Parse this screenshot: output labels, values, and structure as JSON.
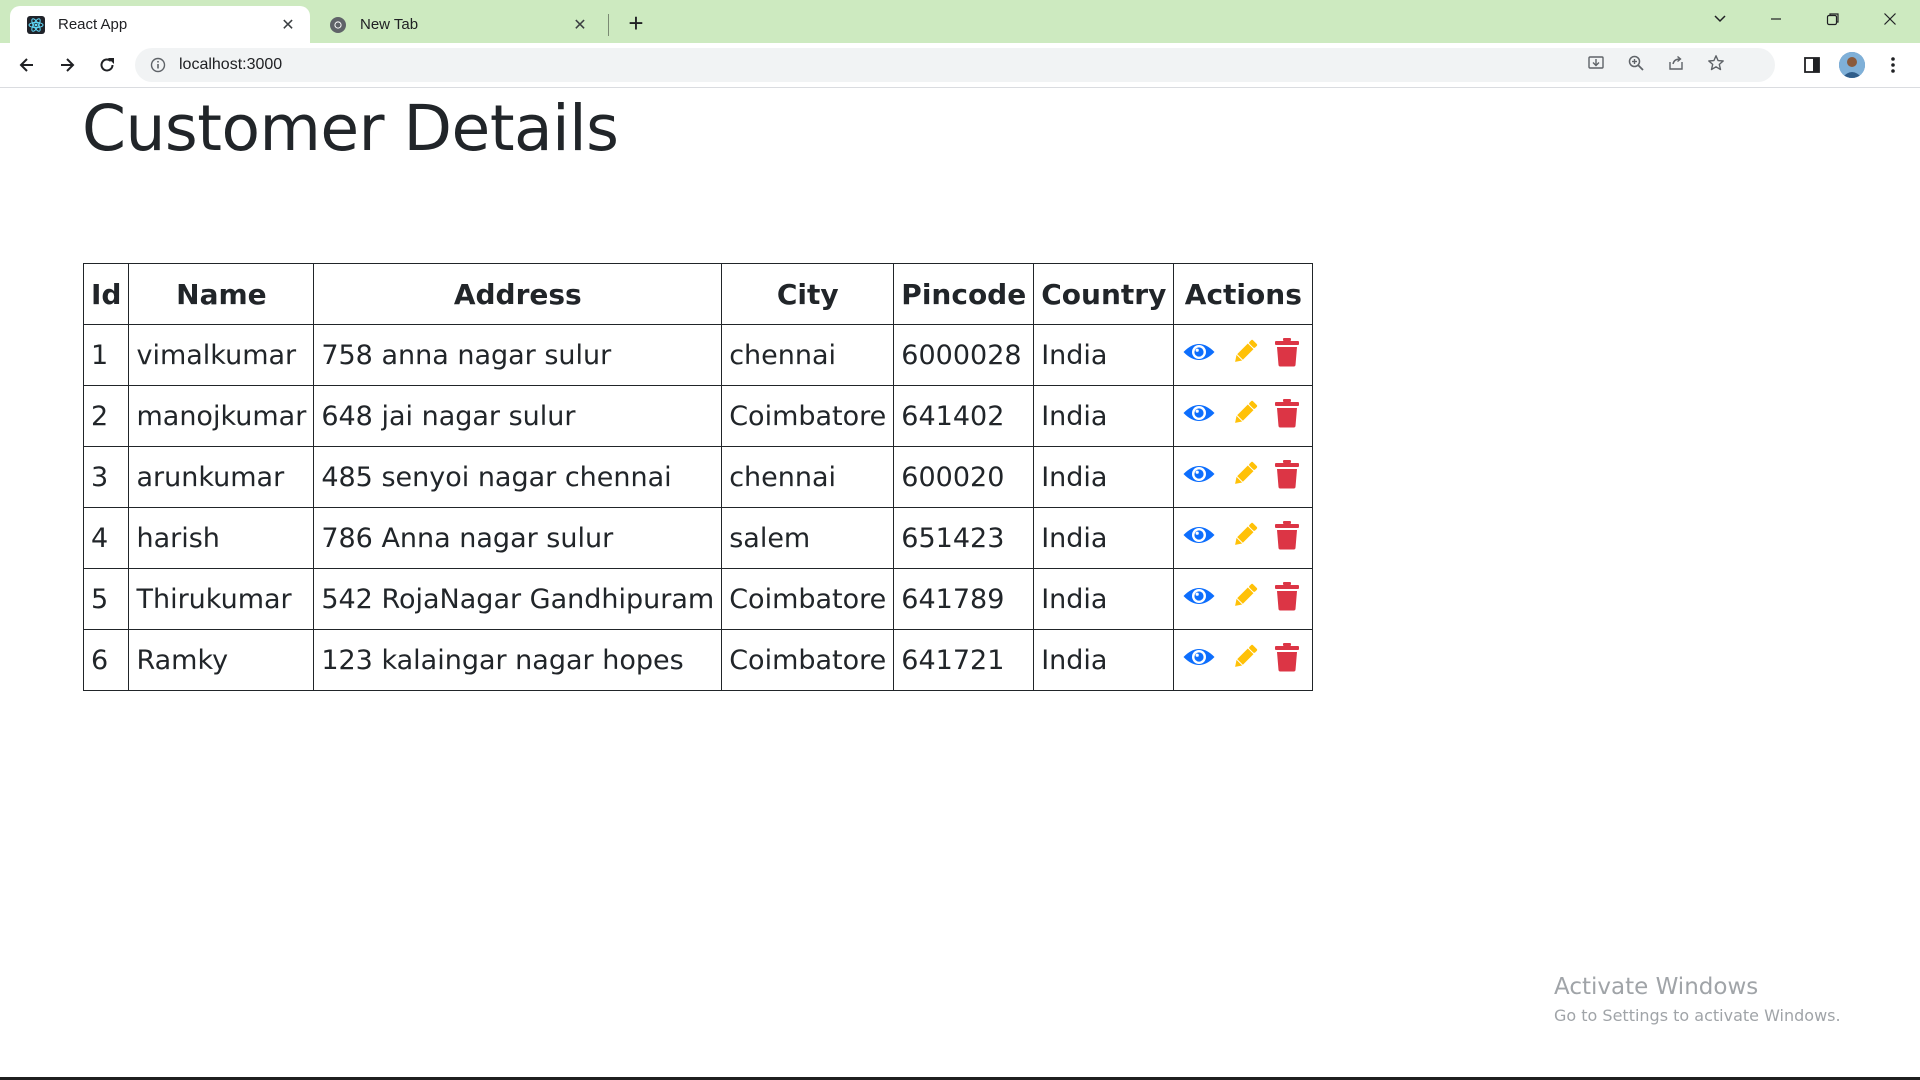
{
  "browser": {
    "tabs": [
      {
        "title": "React App",
        "icon": "react-icon",
        "active": true
      },
      {
        "title": "New Tab",
        "icon": "chrome-icon",
        "active": false
      }
    ],
    "address": "localhost:3000",
    "accent": "#cdeac0"
  },
  "page": {
    "title": "Customer Details"
  },
  "table": {
    "headers": [
      "Id",
      "Name",
      "Address",
      "City",
      "Pincode",
      "Country",
      "Actions"
    ],
    "rows": [
      [
        "1",
        "vimalkumar",
        "758 anna nagar sulur",
        "chennai",
        "6000028",
        "India"
      ],
      [
        "2",
        "manojkumar",
        "648 jai nagar sulur",
        "Coimbatore",
        "641402",
        "India"
      ],
      [
        "3",
        "arunkumar",
        "485 senyoi nagar chennai",
        "chennai",
        "600020",
        "India"
      ],
      [
        "4",
        "harish",
        "786 Anna nagar sulur",
        "salem",
        "651423",
        "India"
      ],
      [
        "5",
        "Thirukumar",
        "542 RojaNagar Gandhipuram",
        "Coimbatore",
        "641789",
        "India"
      ],
      [
        "6",
        "Ramky",
        "123 kalaingar nagar hopes",
        "Coimbatore",
        "641721",
        "India"
      ]
    ],
    "action_icons": [
      "eye-icon",
      "pencil-icon",
      "trash-icon"
    ],
    "action_colors": {
      "view": "#0d6efd",
      "edit": "#ffc107",
      "delete": "#dc3545"
    }
  },
  "watermark": {
    "line1": "Activate Windows",
    "line2": "Go to Settings to activate Windows."
  }
}
